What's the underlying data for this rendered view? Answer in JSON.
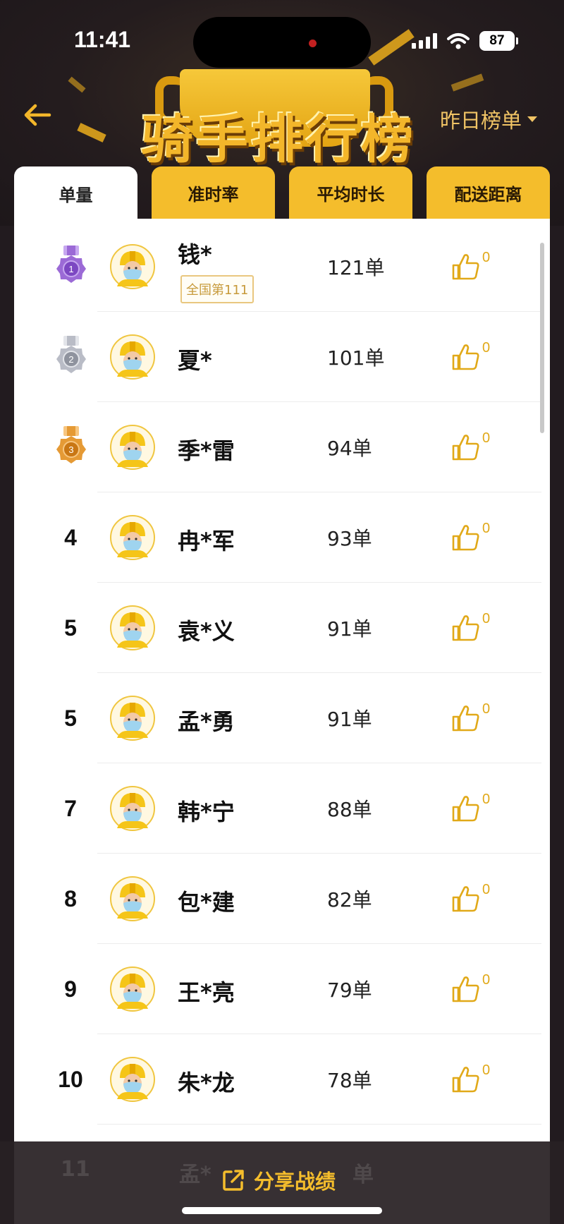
{
  "status_bar": {
    "time": "11:41",
    "battery": "87"
  },
  "header": {
    "title": "骑手排行榜",
    "period_selector": "昨日榜单"
  },
  "tabs": [
    {
      "label": "单量",
      "active": true
    },
    {
      "label": "准时率",
      "active": false
    },
    {
      "label": "平均时长",
      "active": false
    },
    {
      "label": "配送距离",
      "active": false
    }
  ],
  "riders": [
    {
      "rank": "1",
      "medal": "purple",
      "name": "钱*",
      "badge": "全国第111",
      "orders": "121单",
      "likes": "0"
    },
    {
      "rank": "2",
      "medal": "silver",
      "name": "夏*",
      "orders": "101单",
      "likes": "0"
    },
    {
      "rank": "3",
      "medal": "bronze",
      "name": "季*雷",
      "orders": "94单",
      "likes": "0"
    },
    {
      "rank": "4",
      "name": "冉*军",
      "orders": "93单",
      "likes": "0"
    },
    {
      "rank": "5",
      "name": "袁*义",
      "orders": "91单",
      "likes": "0"
    },
    {
      "rank": "5",
      "name": "孟*勇",
      "orders": "91单",
      "likes": "0"
    },
    {
      "rank": "7",
      "name": "韩*宁",
      "orders": "88单",
      "likes": "0"
    },
    {
      "rank": "8",
      "name": "包*建",
      "orders": "82单",
      "likes": "0"
    },
    {
      "rank": "9",
      "name": "王*亮",
      "orders": "79单",
      "likes": "0"
    },
    {
      "rank": "10",
      "name": "朱*龙",
      "orders": "78单",
      "likes": "0"
    }
  ],
  "partial_row": {
    "rank": "11",
    "name": "孟*",
    "orders": "单"
  },
  "share": {
    "label": "分享战绩",
    "icon": "share-icon"
  },
  "colors": {
    "accent": "#f4bd2c",
    "background": "#221b1f",
    "medal_purple": "#9b6ad6",
    "medal_silver": "#b9bcc6",
    "medal_bronze": "#e59a35"
  }
}
